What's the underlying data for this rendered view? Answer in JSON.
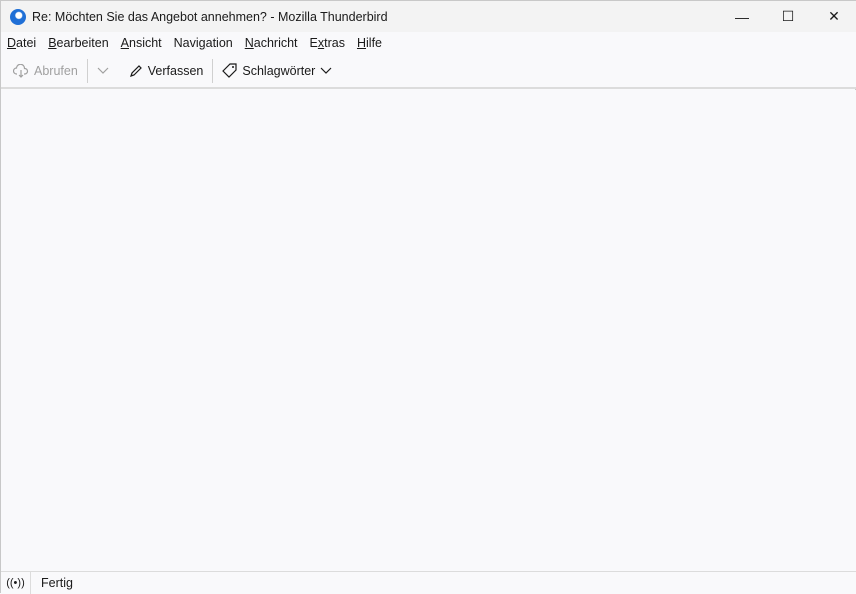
{
  "window": {
    "title": "Re: Möchten Sie das Angebot annehmen? - Mozilla Thunderbird",
    "minimize": "—",
    "maximize": "☐",
    "close": "✕"
  },
  "menu": [
    {
      "pre": "",
      "key": "D",
      "post": "atei"
    },
    {
      "pre": "",
      "key": "B",
      "post": "earbeiten"
    },
    {
      "pre": "",
      "key": "A",
      "post": "nsicht"
    },
    {
      "pre": "Navi",
      "key": "g",
      "post": "ation"
    },
    {
      "pre": "",
      "key": "N",
      "post": "achricht"
    },
    {
      "pre": "E",
      "key": "x",
      "post": "tras"
    },
    {
      "pre": "",
      "key": "H",
      "post": "ilfe"
    }
  ],
  "toolbar": {
    "get_mail": "Abrufen",
    "compose": "Verfassen",
    "tags": "Schlagwörter"
  },
  "status": {
    "text": "Fertig",
    "online_icon": "((•))"
  }
}
